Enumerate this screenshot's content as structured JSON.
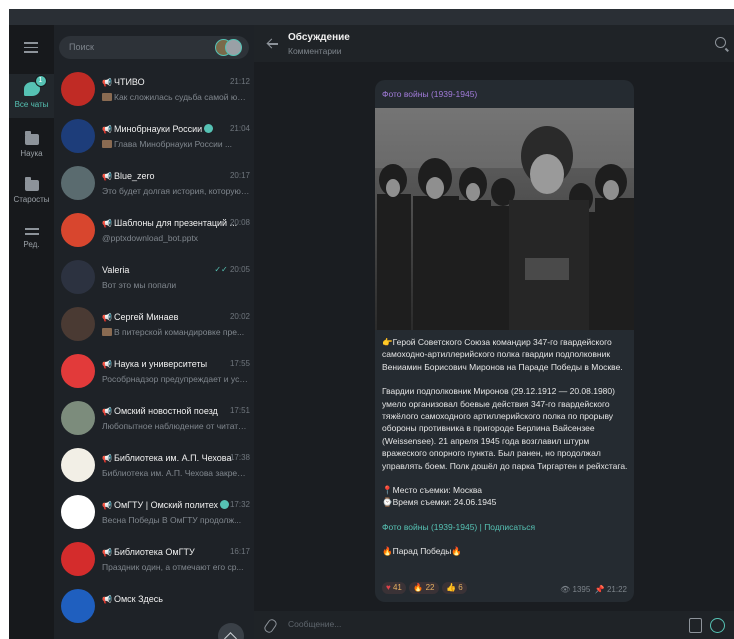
{
  "folders": [
    {
      "label": "Все чаты",
      "badge": "1"
    },
    {
      "label": "Наука"
    },
    {
      "label": "Старосты"
    },
    {
      "label": "Ред."
    }
  ],
  "search": {
    "placeholder": "Поиск"
  },
  "chats": [
    {
      "name": "ЧТИВО",
      "time": "21:12",
      "preview": "Как сложилась судьба самой юной...",
      "channel": true,
      "verified": false,
      "thumb": true,
      "avatar": "#c02b25"
    },
    {
      "name": "Минобрнауки России",
      "time": "21:04",
      "preview": "Глава Минобрнауки России ...",
      "channel": true,
      "verified": true,
      "thumb": true,
      "avatar": "#1d3d7a"
    },
    {
      "name": "Blue_zero",
      "time": "20:17",
      "preview": "Это будет долгая история, которую я ...",
      "channel": true,
      "verified": false,
      "thumb": false,
      "avatar": "#5a6b6f"
    },
    {
      "name": "Шаблоны для презентаций ...",
      "time": "20:08",
      "preview": "@pptxdownload_bot.pptx",
      "channel": true,
      "verified": false,
      "thumb": false,
      "avatar": "#d8462e"
    },
    {
      "name": "Valeria",
      "time": "20:05",
      "preview": "Вот это мы попали",
      "channel": false,
      "verified": false,
      "thumb": false,
      "read": true,
      "avatar": "#2c3240"
    },
    {
      "name": "Сергей Минаев",
      "time": "20:02",
      "preview": "В питерской командировке пре...",
      "channel": true,
      "verified": false,
      "thumb": true,
      "avatar": "#4a3a33"
    },
    {
      "name": "Наука и университеты",
      "time": "17:55",
      "preview": "Рособрнадзор предупреждает и успо...",
      "channel": true,
      "verified": false,
      "thumb": false,
      "avatar": "#e23a3a"
    },
    {
      "name": "Омский новостной поезд",
      "time": "17:51",
      "preview": "Любопытное наблюдение от читател...",
      "channel": true,
      "verified": false,
      "thumb": false,
      "avatar": "#7c8c7c"
    },
    {
      "name": "Библиотека им. А.П. Чехова",
      "time": "17:38",
      "preview": "Библиотека им. А.П. Чехова закрепил(...",
      "channel": true,
      "verified": false,
      "thumb": false,
      "avatar": "#f2efe6"
    },
    {
      "name": "ОмГТУ | Омский политех",
      "time": "17:32",
      "preview": "Весна Победы  В ОмГТУ продолж...",
      "channel": true,
      "verified": true,
      "thumb": false,
      "avatar": "#ffffff"
    },
    {
      "name": "Библиотека ОмГТУ",
      "time": "16:17",
      "preview": "Праздник один, а отмечают его ср...",
      "channel": true,
      "verified": false,
      "thumb": false,
      "avatar": "#d42c2c"
    },
    {
      "name": "Омск Здесь",
      "time": "",
      "preview": "",
      "channel": true,
      "verified": false,
      "thumb": false,
      "avatar": "#1f5fbf"
    }
  ],
  "header": {
    "title": "Обсуждение",
    "subtitle": "Комментарии"
  },
  "post": {
    "source": "Фото войны (1939-1945)",
    "paragraphs": [
      "👉Герой Советского Союза командир 347-го гвардейского самоходно-артиллерийского полка гвардии подполковник Вениамин Борисович Миронов на Параде Победы в Москве.",
      "Гвардии подполковник Миронов (29.12.1912 — 20.08.1980) умело организовал боевые действия 347-го гвардейского тяжёлого самоходного артиллерийского полка по прорыву обороны противника в пригороде Берлина Вайсензее (Weissensee). 21 апреля 1945 года возглавил штурм вражеского опорного пункта. Был ранен, но продолжал управлять боем. Полк дошёл до парка Тиргартен и рейхстага.",
      "📍Место съемки: Москва\n⌚Время съемки: 24.06.1945"
    ],
    "link": "Фото войны (1939-1945) | Подписаться",
    "closing": "🔥Парад Победы🔥",
    "reactions": [
      {
        "emoji": "♥",
        "count": "41"
      },
      {
        "emoji": "🔥",
        "count": "22"
      },
      {
        "emoji": "👍",
        "count": "6"
      }
    ],
    "views": "1395",
    "time": "21:22"
  },
  "composer": {
    "placeholder": "Сообщение..."
  },
  "colors": {
    "accent": "#56c2b4",
    "source": "#a17bd9",
    "panel": "#1e2227",
    "bubble": "#252b31"
  }
}
